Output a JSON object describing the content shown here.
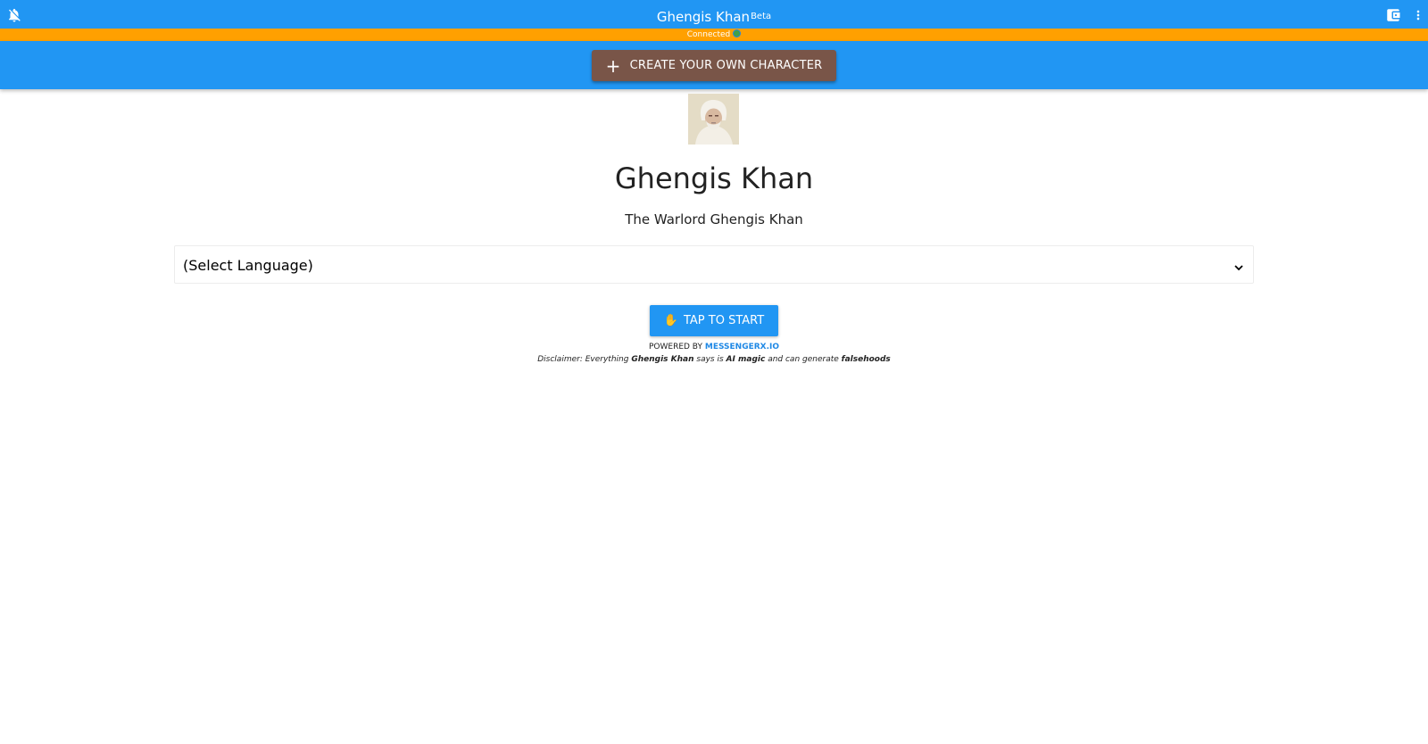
{
  "appbar": {
    "title": "Ghengis Khan",
    "badge": "Beta",
    "left_icon": "notifications-off-icon",
    "right_icons": [
      "wallet-icon",
      "more-vert-icon"
    ]
  },
  "status": {
    "text": "Connected",
    "icon": "globe-icon"
  },
  "toolbar": {
    "create_label": "CREATE YOUR OWN CHARACTER",
    "create_icon": "plus-icon"
  },
  "character": {
    "name": "Ghengis Khan",
    "description": "The Warlord Ghengis Khan",
    "avatar_alt": "Ghengis Khan portrait"
  },
  "language_select": {
    "selected": "(Select Language)"
  },
  "start_button": {
    "emoji": "✋",
    "label": "TAP TO START"
  },
  "footer": {
    "powered_prefix": "POWERED BY",
    "powered_link": "MESSENGERX.IO",
    "disclaimer_1": "Disclaimer: Everything",
    "disclaimer_name": "Ghengis Khan",
    "disclaimer_2": "says is",
    "disclaimer_ai": "AI magic",
    "disclaimer_3": "and can generate",
    "disclaimer_false": "falsehoods"
  },
  "colors": {
    "primary": "#2196f3",
    "status": "#ffa000",
    "create_button": "#795548",
    "link": "#1e88e5"
  }
}
